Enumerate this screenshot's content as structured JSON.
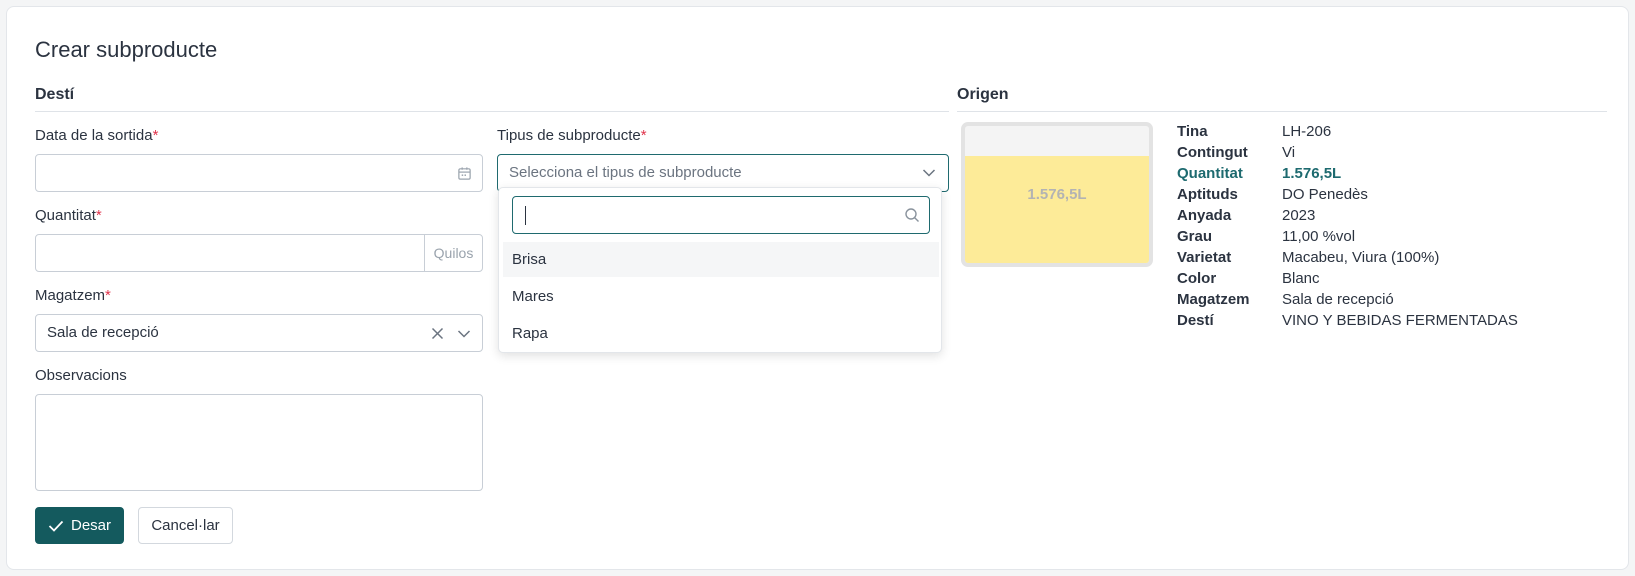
{
  "page_title": "Crear subproducte",
  "destination": {
    "section_title": "Destí",
    "date_label": "Data de la sortida",
    "type_label": "Tipus de subproducte",
    "type_placeholder": "Selecciona el tipus de subproducte",
    "quantity_label": "Quantitat",
    "quantity_unit": "Quilos",
    "warehouse_label": "Magatzem",
    "warehouse_value": "Sala de recepció",
    "notes_label": "Observacions",
    "required_mark": "*"
  },
  "dropdown": {
    "search_value": "",
    "options": [
      "Brisa",
      "Mares",
      "Rapa"
    ]
  },
  "actions": {
    "save_label": "Desar",
    "cancel_label": "Cancel·lar"
  },
  "origin": {
    "section_title": "Origen",
    "tank_label": "1.576,5L",
    "tank_fill_fraction": 0.78,
    "tank_fill_color": "#fdeb98",
    "details": [
      {
        "key": "Tina",
        "value": "LH-206"
      },
      {
        "key": "Contingut",
        "value": "Vi"
      },
      {
        "key": "Quantitat",
        "value": "1.576,5L"
      },
      {
        "key": "Aptituds",
        "value": "DO Penedès"
      },
      {
        "key": "Anyada",
        "value": "2023"
      },
      {
        "key": "Grau",
        "value": "11,00 %vol"
      },
      {
        "key": "Varietat",
        "value": "Macabeu, Viura (100%)"
      },
      {
        "key": "Color",
        "value": "Blanc"
      },
      {
        "key": "Magatzem",
        "value": "Sala de recepció"
      },
      {
        "key": "Destí",
        "value": "VINO Y BEBIDAS FERMENTADAS"
      }
    ]
  },
  "colors": {
    "accent": "#145a5e",
    "highlight": "#1d6a6f",
    "required": "#e0334b"
  }
}
